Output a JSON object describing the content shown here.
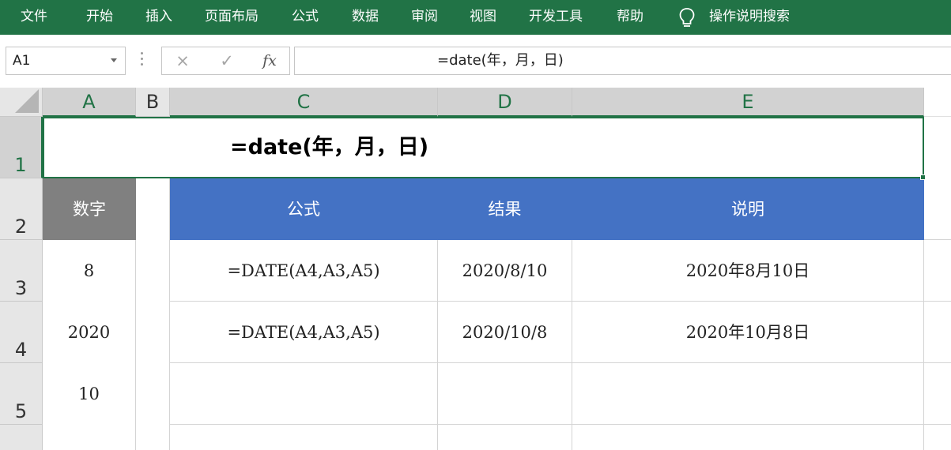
{
  "ribbon": {
    "tabs": [
      "文件",
      "开始",
      "插入",
      "页面布局",
      "公式",
      "数据",
      "审阅",
      "视图",
      "开发工具",
      "帮助"
    ],
    "tell_me_icon": "lightbulb-icon",
    "tell_me": "操作说明搜索",
    "accent_color": "#217346"
  },
  "formula_bar": {
    "name_box": "A1",
    "cancel_icon": "×",
    "enter_icon": "✓",
    "fx_label": "fx",
    "formula": "=date(年，月，日)"
  },
  "grid": {
    "columns": [
      "A",
      "B",
      "C",
      "D",
      "E"
    ],
    "rows": [
      "1",
      "2",
      "3",
      "4",
      "5"
    ],
    "active_cell": "A1",
    "title": "=date(年，月，日)",
    "a_header": "数字",
    "a_values": [
      "8",
      "2020",
      "10"
    ],
    "table": {
      "headers": [
        "公式",
        "结果",
        "说明"
      ],
      "rows": [
        [
          "=DATE(A4,A3,A5)",
          "2020/8/10",
          "2020年8月10日"
        ],
        [
          "=DATE(A4,A3,A5)",
          "2020/10/8",
          "2020年10月8日"
        ]
      ]
    },
    "colors": {
      "gray_header": "#808080",
      "blue_header": "#4472c4"
    }
  }
}
